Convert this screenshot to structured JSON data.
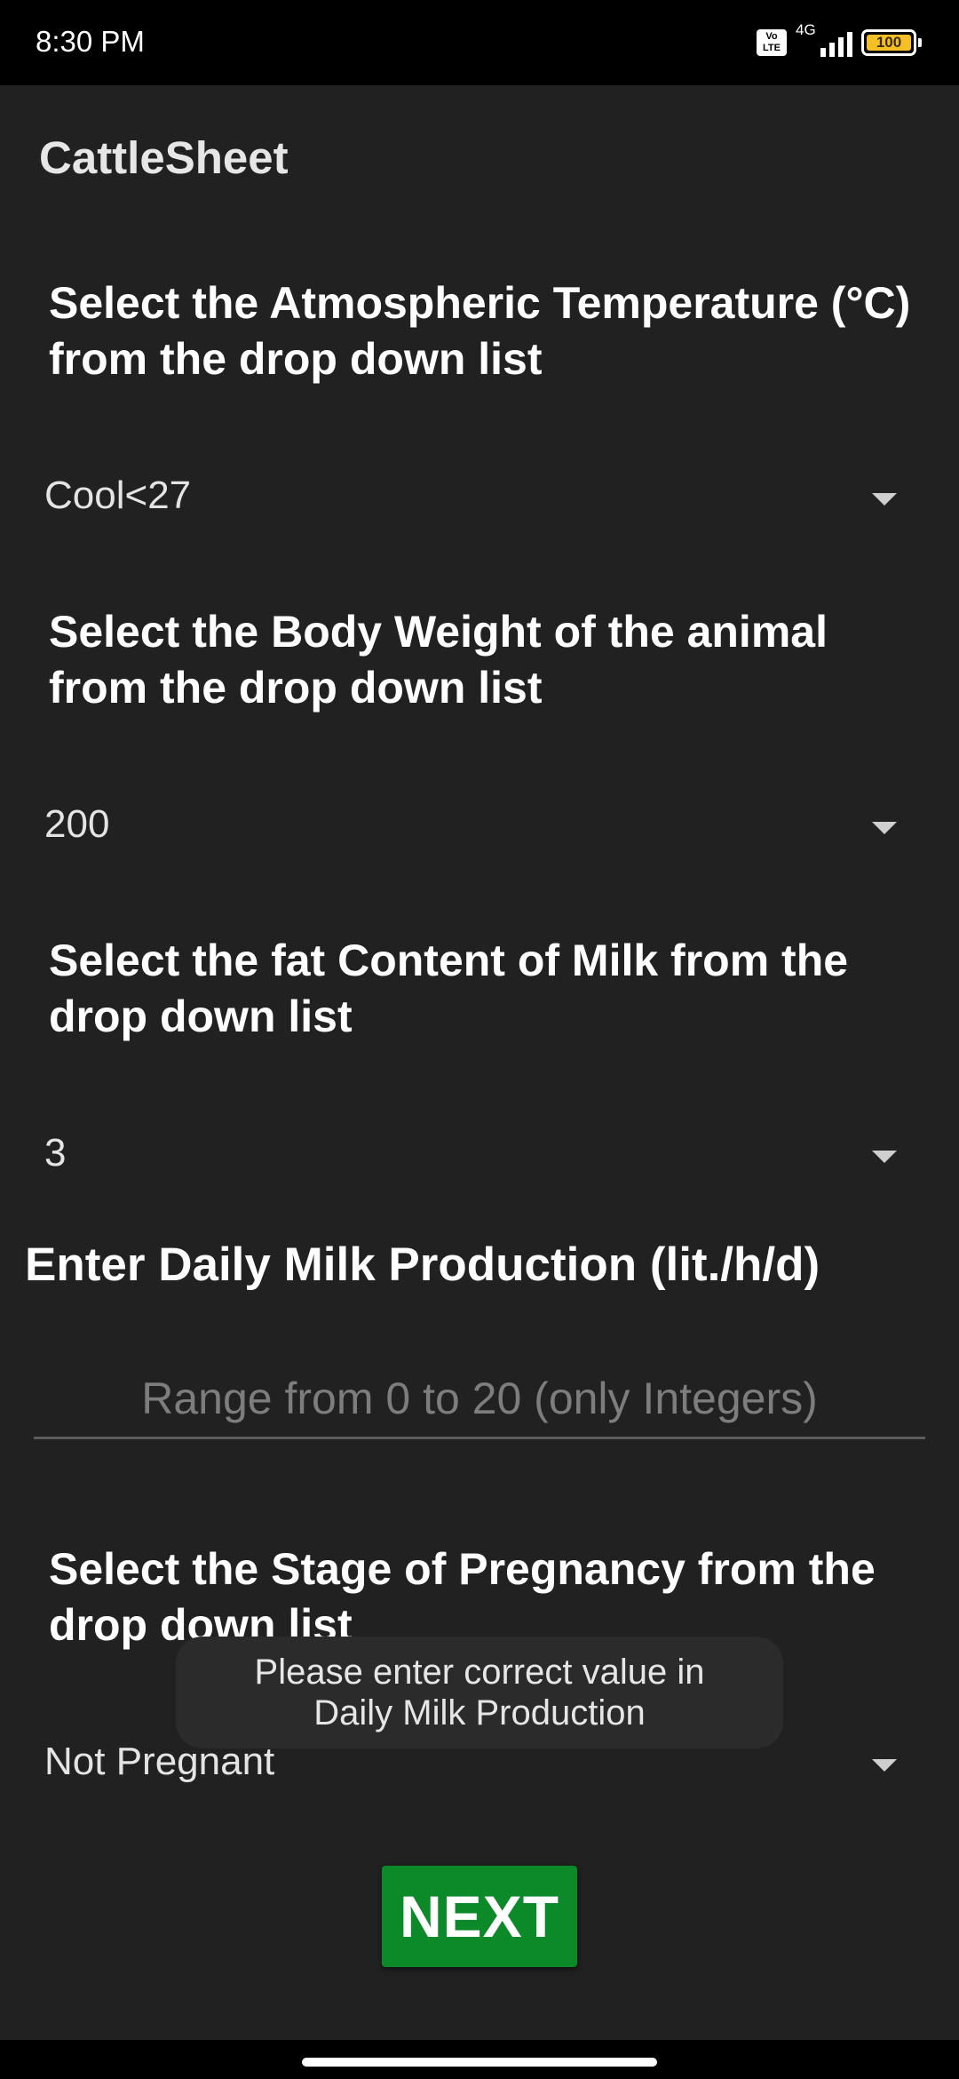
{
  "status_bar": {
    "time": "8:30 PM",
    "volte_label": "Vo LTE",
    "network_label": "4G",
    "battery_level": "100",
    "icons": [
      "volte-icon",
      "signal-icon",
      "battery-icon"
    ]
  },
  "app": {
    "title": "CattleSheet"
  },
  "form": {
    "temperature": {
      "question": "Select the Atmospheric Temperature (°C) from the drop down list",
      "selected": "Cool<27"
    },
    "body_weight": {
      "question": "Select the Body Weight of the animal from the drop down list",
      "selected": "200"
    },
    "fat_content": {
      "question": "Select the fat Content of Milk from the drop down list",
      "selected": "3"
    },
    "milk_production": {
      "label": "Enter Daily Milk Production (lit./h/d)",
      "value": "",
      "placeholder": "Range from 0 to 20 (only Integers)"
    },
    "pregnancy": {
      "question": "Select the Stage of Pregnancy from the drop down list",
      "selected": "Not Pregnant"
    },
    "next_label": "NEXT"
  },
  "toast": {
    "message": "Please enter correct value in Daily Milk Production"
  },
  "colors": {
    "background": "#212121",
    "status_bar": "#000000",
    "next_button": "#0c8a2a",
    "battery": "#f4c025"
  }
}
